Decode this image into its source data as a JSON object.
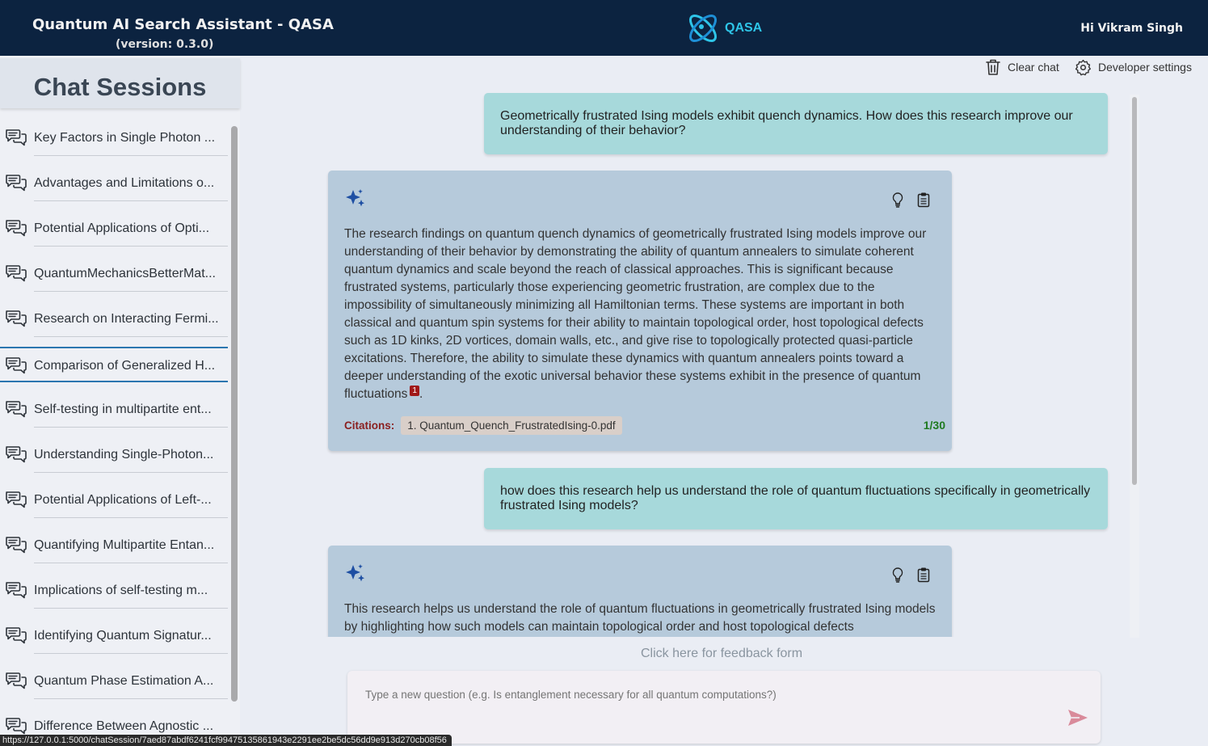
{
  "header": {
    "title": "Quantum AI Search Assistant - QASA",
    "version": "(version: 0.3.0)",
    "logo_text": "QASA",
    "greeting": "Hi Vikram Singh"
  },
  "sidebar": {
    "title": "Chat Sessions",
    "active_index": 5,
    "items": [
      {
        "label": "Key Factors in Single Photon ..."
      },
      {
        "label": "Advantages and Limitations o..."
      },
      {
        "label": "Potential Applications of Opti..."
      },
      {
        "label": "QuantumMechanicsBetterMat..."
      },
      {
        "label": "Research on Interacting Fermi..."
      },
      {
        "label": "Comparison of Generalized H..."
      },
      {
        "label": "Self-testing in multipartite ent..."
      },
      {
        "label": "Understanding Single-Photon..."
      },
      {
        "label": "Potential Applications of Left-..."
      },
      {
        "label": "Quantifying Multipartite Entan..."
      },
      {
        "label": "Implications of self-testing m..."
      },
      {
        "label": "Identifying Quantum Signatur..."
      },
      {
        "label": "Quantum Phase Estimation A..."
      },
      {
        "label": "Difference Between Agnostic ..."
      }
    ]
  },
  "status_url": "https://127.0.0.1:5000/chatSession/7aed87abdf6241fcf99475135861943e2291ee2be5dc56dd9e913d270cb08f56",
  "toolbar": {
    "clear_chat": "Clear chat",
    "developer_settings": "Developer settings"
  },
  "chat": {
    "messages": [
      {
        "role": "user",
        "text": "Geometrically frustrated Ising models exhibit quench dynamics. How does this research improve our understanding of their behavior?"
      },
      {
        "role": "assistant",
        "text": "The research findings on quantum quench dynamics of geometrically frustrated Ising models improve our understanding of their behavior by demonstrating the ability of quantum annealers to simulate coherent quantum dynamics and scale beyond the reach of classical approaches. This is significant because frustrated systems, particularly those experiencing geometric frustration, are complex due to the impossibility of simultaneously minimizing all Hamiltonian terms. These systems are important in both classical and quantum spin systems for their ability to maintain topological order, host topological defects such as 1D kinks, 2D vortices, domain walls, etc., and give rise to topologically protected quasi-particle excitations. Therefore, the ability to simulate these dynamics with quantum annealers points toward a deeper understanding of the exotic universal behavior these systems exhibit in the presence of quantum fluctuations",
        "citation_marker": "1",
        "citations_label": "Citations:",
        "citation": "1. Quantum_Quench_FrustratedIsing-0.pdf",
        "counter": "1/30"
      },
      {
        "role": "user",
        "text": "how does this research help us understand the role of quantum fluctuations specifically in geometrically frustrated Ising models?"
      },
      {
        "role": "assistant",
        "text": "This research helps us understand the role of quantum fluctuations in geometrically frustrated Ising models by highlighting how such models can maintain topological order and host topological defects"
      }
    ]
  },
  "feedback_link": "Click here for feedback form",
  "input": {
    "placeholder": "Type a new question (e.g. Is entanglement necessary for all quantum computations?)",
    "value": ""
  },
  "colors": {
    "header_bg": "#0c2340",
    "logo_accent": "#2ec5e8",
    "user_bubble": "#a7d9db",
    "assistant_bubble": "#b6cadb",
    "active_session_border": "#2b76b0",
    "citation_label": "#8a1f1f",
    "counter": "#1f7a1f",
    "send_icon": "#d98a9a"
  },
  "icons": {
    "session": "chat-bubbles-icon",
    "clear": "trash-icon",
    "settings": "gear-icon",
    "assistant": "sparkle-icon",
    "explain": "lightbulb-icon",
    "copy": "clipboard-icon",
    "send": "send-icon"
  }
}
